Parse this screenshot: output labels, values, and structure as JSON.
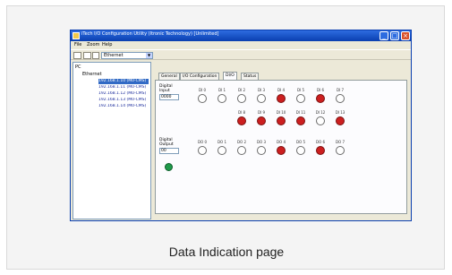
{
  "window": {
    "title": "iTech I/O Configuration Utility (Itronic Technology) [Unlimited]"
  },
  "menu": [
    "File",
    "Zoom",
    "Help"
  ],
  "toolbar": {
    "dropdown_value": "Ethernet"
  },
  "tree": {
    "root": "PC",
    "node": "Ethernet",
    "devices": [
      "192.168.1.10 (M0-CMS)",
      "192.168.1.11 (M0-CMS)",
      "192.168.1.12 (M0-CMS)",
      "192.168.1.13 (M0-CMS)",
      "192.168.1.14 (M0-CMS)"
    ],
    "selected_index": 0
  },
  "tabs": [
    "General",
    "I/O Configuration",
    "DI/O",
    "Status"
  ],
  "active_tab": 2,
  "digital_input": {
    "label": "Digital Input",
    "readout": "0000",
    "channels": [
      {
        "name": "DI 0",
        "on": false
      },
      {
        "name": "DI 1",
        "on": false
      },
      {
        "name": "DI 2",
        "on": false
      },
      {
        "name": "DI 3",
        "on": false
      },
      {
        "name": "DI 4",
        "on": true
      },
      {
        "name": "DI 5",
        "on": false
      },
      {
        "name": "DI 6",
        "on": true
      },
      {
        "name": "DI 7",
        "on": false
      },
      {
        "name": "DI 8",
        "on": true
      },
      {
        "name": "DI 9",
        "on": true
      },
      {
        "name": "DI 10",
        "on": true
      },
      {
        "name": "DI 11",
        "on": true
      },
      {
        "name": "DI 12",
        "on": false
      },
      {
        "name": "DI 13",
        "on": true
      }
    ]
  },
  "digital_output": {
    "label": "Digital Output",
    "readout": "00",
    "status_color": "#1f9a4a",
    "channels": [
      {
        "name": "DO 0",
        "on": false
      },
      {
        "name": "DO 1",
        "on": false
      },
      {
        "name": "DO 2",
        "on": false
      },
      {
        "name": "DO 3",
        "on": false
      },
      {
        "name": "DO 4",
        "on": true
      },
      {
        "name": "DO 5",
        "on": false
      },
      {
        "name": "DO 6",
        "on": true
      },
      {
        "name": "DO 7",
        "on": false
      }
    ]
  },
  "caption": "Data Indication page"
}
